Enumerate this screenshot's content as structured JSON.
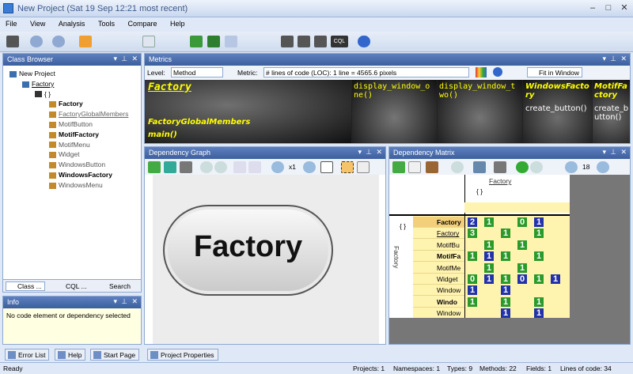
{
  "window": {
    "title": "New Project  (Sat 19 Sep 12:21 most recent)"
  },
  "menu": [
    "File",
    "View",
    "Analysis",
    "Tools",
    "Compare",
    "Help"
  ],
  "class_browser": {
    "title": "Class Browser",
    "items": [
      {
        "label": "New Project",
        "bold": false
      },
      {
        "label": "Factory",
        "bold": false
      },
      {
        "label": "{ }",
        "bold": false
      },
      {
        "label": "Factory",
        "bold": true
      },
      {
        "label": "FactoryGlobalMembers",
        "bold": false
      },
      {
        "label": "MotifButton",
        "bold": false
      },
      {
        "label": "MotifFactory",
        "bold": true
      },
      {
        "label": "MotifMenu",
        "bold": false
      },
      {
        "label": "Widget",
        "bold": false
      },
      {
        "label": "WindowsButton",
        "bold": false
      },
      {
        "label": "WindowsFactory",
        "bold": true
      },
      {
        "label": "WindowsMenu",
        "bold": false
      }
    ],
    "tabs": [
      "Class ...",
      "CQL ...",
      "Search"
    ]
  },
  "info": {
    "title": "Info",
    "text": "No code element or dependency selected"
  },
  "metrics": {
    "title": "Metrics",
    "level_label": "Level:",
    "level_value": "Method",
    "metric_label": "Metric:",
    "metric_value": "# lines of code (LOC):  1 line = 4565.6 pixels",
    "fit": "Fit in Window",
    "cells": [
      "Factory",
      "FactoryGlobalMembers",
      "main()",
      "display_window_one()",
      "display_window_two()",
      "WindowsFactory",
      "create_button()",
      "MotifFactory",
      "create_button()"
    ]
  },
  "graph": {
    "title": "Dependency Graph",
    "zoom": "x1",
    "node": "Factory"
  },
  "matrix": {
    "title": "Dependency Matrix",
    "zoom": "18",
    "top_label": "Factory",
    "ns": "{ }",
    "side": "Factory",
    "rows": [
      "Factory",
      "Factory",
      "MotifBu",
      "MotifFa",
      "MotifMe",
      "Widget",
      "Window",
      "Windo",
      "Window"
    ],
    "nums": [
      [
        "2",
        "1",
        "",
        "0",
        "1",
        ""
      ],
      [
        "3",
        "",
        "1",
        "",
        "1",
        ""
      ],
      [
        "",
        "1",
        "",
        "1",
        "",
        ""
      ],
      [
        "1",
        "1",
        "1",
        "",
        "1",
        ""
      ],
      [
        "",
        "1",
        "",
        "1",
        "",
        ""
      ],
      [
        "0",
        "1",
        "1",
        "0",
        "1",
        "1"
      ],
      [
        "1",
        "",
        "1",
        "",
        "",
        ""
      ],
      [
        "1",
        "",
        "1",
        "",
        "1",
        ""
      ],
      [
        "",
        "",
        "1",
        "",
        "1",
        ""
      ]
    ]
  },
  "bottom_tabs": [
    "Error List",
    "Help",
    "Start Page",
    "Project Properties"
  ],
  "status": {
    "left": "Ready",
    "projects": "Projects: 1",
    "namespaces": "Namespaces: 1",
    "types": "Types: 9",
    "methods": "Methods: 22",
    "fields": "Fields: 1",
    "loc": "Lines of code: 34"
  }
}
